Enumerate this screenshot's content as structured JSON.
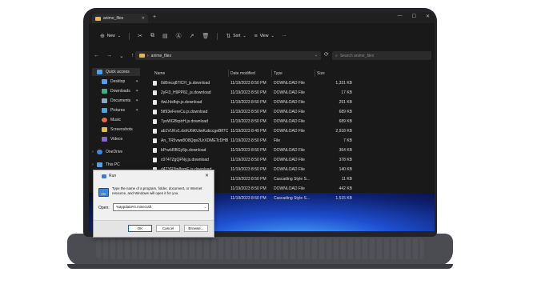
{
  "explorer": {
    "tab_title": "anime_files",
    "window_controls": [
      "—",
      "☐",
      "✕"
    ],
    "toolbar": {
      "new_label": "New",
      "sort_label": "Sort",
      "view_label": "View",
      "more_label": "···"
    },
    "nav": {
      "back": "←",
      "forward": "→",
      "up": "↑"
    },
    "address": {
      "path": "anime_files"
    },
    "search": {
      "placeholder": "Search anime_files"
    },
    "sidebar": [
      {
        "label": "Quick access",
        "icon": "star-icon",
        "color": "#4aa3f2",
        "pinned": false
      },
      {
        "label": "Desktop",
        "icon": "desktop-icon",
        "color": "#4aa3f2",
        "pinned": true
      },
      {
        "label": "Downloads",
        "icon": "downloads-icon",
        "color": "#36b37e",
        "pinned": true
      },
      {
        "label": "Documents",
        "icon": "documents-icon",
        "color": "#8fa7c4",
        "pinned": true
      },
      {
        "label": "Pictures",
        "icon": "pictures-icon",
        "color": "#47a7e6",
        "pinned": true
      },
      {
        "label": "Music",
        "icon": "music-icon",
        "color": "#e96a3c",
        "pinned": false
      },
      {
        "label": "Screenshots",
        "icon": "folder-icon",
        "color": "#e8b84b",
        "pinned": false
      },
      {
        "label": "Videos",
        "icon": "videos-icon",
        "color": "#8a63d2",
        "pinned": false
      },
      {
        "label": "OneDrive",
        "icon": "cloud-icon",
        "color": "#3c8ae0",
        "pinned": false
      },
      {
        "label": "This PC",
        "icon": "pc-icon",
        "color": "#4aa3f2",
        "pinned": false
      }
    ],
    "columns": {
      "name": "Name",
      "date": "Date modified",
      "type": "Type",
      "size": "Size"
    },
    "files": [
      {
        "name": "0d0mcq87ICH_js.download",
        "date": "11/19/2023 8:50 PM",
        "type": "DOWNLOAD File",
        "size": "1,331 KB"
      },
      {
        "name": "2yFi3_H9PP8J_js.download",
        "date": "11/19/2023 8:50 PM",
        "type": "DOWNLOAD File",
        "size": "17 KB"
      },
      {
        "name": "4wLhlsfbjn.js.download",
        "date": "11/19/2023 8:50 PM",
        "type": "DOWNLOAD File",
        "size": "291 KB"
      },
      {
        "name": "5tf93eFereCu.js.download",
        "date": "11/19/2023 8:50 PM",
        "type": "DOWNLOAD File",
        "size": "689 KB"
      },
      {
        "name": "7yoWGBrptrH.js.download",
        "date": "11/19/2023 8:50 PM",
        "type": "DOWNLOAD File",
        "size": "689 KB"
      },
      {
        "name": "ab1VUKv1.dshU6iKUiwKubccgeBlf7Cdwtt...",
        "date": "11/19/2023 8:49 PM",
        "type": "DOWNLOAD File",
        "size": "2,918 KB"
      },
      {
        "name": "An_TR5vwe8O8Qqe2UrXDMETcDHBMt6u...",
        "date": "11/19/2023 8:50 PM",
        "type": "File",
        "size": "7 KB"
      },
      {
        "name": "bPnzkRBGy5js.download",
        "date": "11/19/2023 8:50 PM",
        "type": "DOWNLOAD File",
        "size": "364 KB"
      },
      {
        "name": "c0747ZgQFNy.js.download",
        "date": "11/19/2023 8:50 PM",
        "type": "DOWNLOAD File",
        "size": "378 KB"
      },
      {
        "name": "d4TYR3tn8nmE.js.download",
        "date": "11/19/2023 8:50 PM",
        "type": "DOWNLOAD File",
        "size": "140 KB"
      },
      {
        "name": "",
        "date": "11/19/2023 8:50 PM",
        "type": "Cascading Style S...",
        "size": "11 KB"
      },
      {
        "name": "",
        "date": "11/19/2023 8:50 PM",
        "type": "DOWNLOAD File",
        "size": "442 KB"
      },
      {
        "name": "",
        "date": "11/19/2023 8:50 PM",
        "type": "Cascading Style S...",
        "size": "1,515 KB"
      }
    ]
  },
  "run_dialog": {
    "title": "Run",
    "close": "✕",
    "description": "Type the name of a program, folder, document, or Internet resource, and Windows will open it for you.",
    "open_label": "Open:",
    "input_value": "%appdata%\\.minecraft",
    "buttons": {
      "ok": "OK",
      "cancel": "Cancel",
      "browse": "Browse..."
    }
  }
}
